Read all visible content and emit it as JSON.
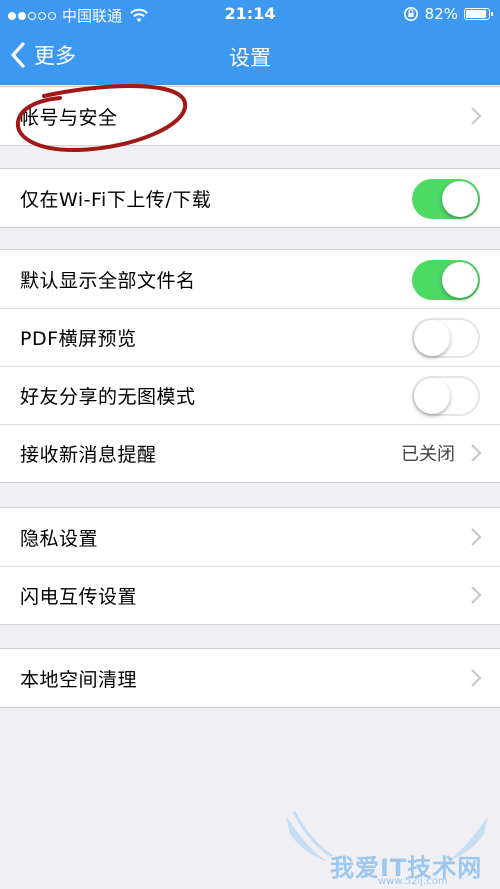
{
  "status_bar": {
    "carrier": "中国联通",
    "time": "21:14",
    "battery_text": "82%",
    "battery_level": 0.82
  },
  "nav": {
    "back_label": "更多",
    "title": "设置"
  },
  "rows": {
    "account_security": "帐号与安全",
    "wifi_only": "仅在Wi-Fi下上传/下载",
    "show_filenames": "默认显示全部文件名",
    "pdf_landscape": "PDF横屏预览",
    "friend_share_noimage": "好友分享的无图模式",
    "new_msg_reminder": "接收新消息提醒",
    "new_msg_reminder_value": "已关闭",
    "privacy": "隐私设置",
    "flash_transfer": "闪电互传设置",
    "local_cleanup": "本地空间清理"
  },
  "toggles": {
    "wifi_only": true,
    "show_filenames": true,
    "pdf_landscape": false,
    "friend_share_noimage": false
  },
  "watermark": {
    "text": "我爱IT技术网",
    "url": "www.52ij.com"
  },
  "colors": {
    "nav_blue": "#3d98f1",
    "toggle_on": "#4cd964",
    "background": "#efeff4",
    "annotation": "#a01818"
  }
}
